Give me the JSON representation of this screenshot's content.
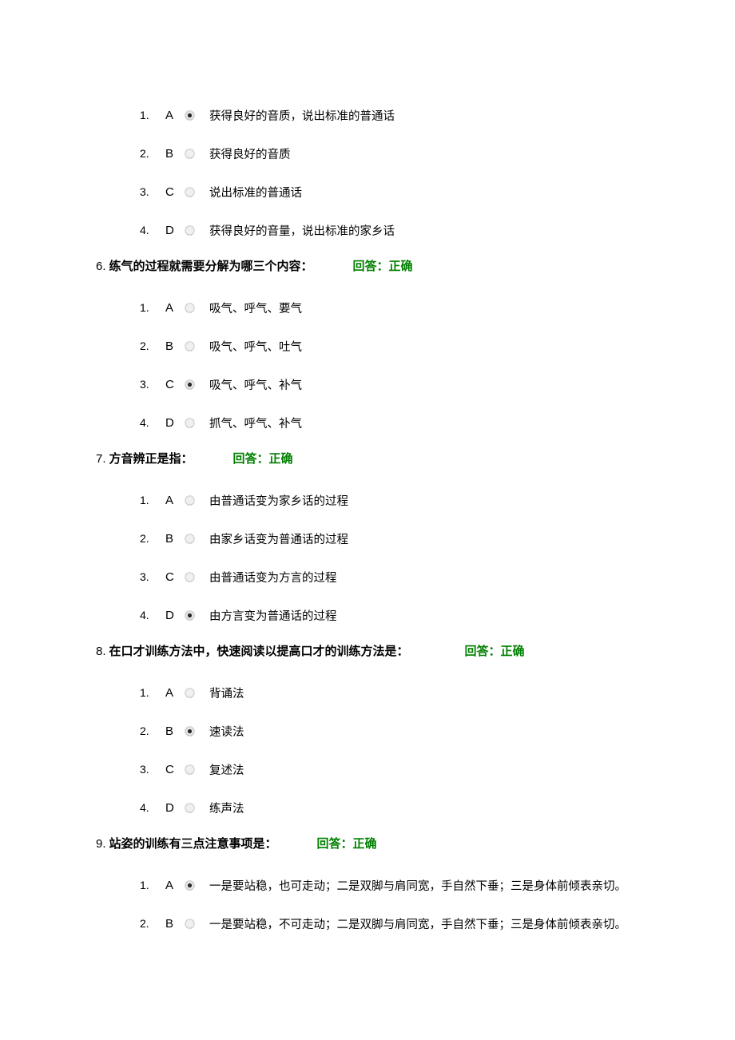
{
  "labels": {
    "answer_prefix": "回答：",
    "correct": "正确"
  },
  "block_a": {
    "options": [
      {
        "num": "1.",
        "letter": "A",
        "selected": true,
        "text": "获得良好的音质，说出标准的普通话"
      },
      {
        "num": "2.",
        "letter": "B",
        "selected": false,
        "text": "获得良好的音质"
      },
      {
        "num": "3.",
        "letter": "C",
        "selected": false,
        "text": "说出标准的普通话"
      },
      {
        "num": "4.",
        "letter": "D",
        "selected": false,
        "text": "获得良好的音量，说出标准的家乡话"
      }
    ]
  },
  "questions": [
    {
      "num": "6.",
      "text": "练气的过程就需要分解为哪三个内容：",
      "answer_gap": "50px",
      "options": [
        {
          "num": "1.",
          "letter": "A",
          "selected": false,
          "text": "吸气、呼气、要气"
        },
        {
          "num": "2.",
          "letter": "B",
          "selected": false,
          "text": "吸气、呼气、吐气"
        },
        {
          "num": "3.",
          "letter": "C",
          "selected": true,
          "text": "吸气、呼气、补气"
        },
        {
          "num": "4.",
          "letter": "D",
          "selected": false,
          "text": "抓气、呼气、补气"
        }
      ]
    },
    {
      "num": "7.",
      "text": "方音辨正是指：",
      "answer_gap": "50px",
      "options": [
        {
          "num": "1.",
          "letter": "A",
          "selected": false,
          "text": "由普通话变为家乡话的过程"
        },
        {
          "num": "2.",
          "letter": "B",
          "selected": false,
          "text": "由家乡话变为普通话的过程"
        },
        {
          "num": "3.",
          "letter": "C",
          "selected": false,
          "text": "由普通话变为方言的过程"
        },
        {
          "num": "4.",
          "letter": "D",
          "selected": true,
          "text": "由方言变为普通话的过程"
        }
      ]
    },
    {
      "num": "8.",
      "text": "在口才训练方法中，快速阅读以提高口才的训练方法是：",
      "answer_gap": "70px",
      "options": [
        {
          "num": "1.",
          "letter": "A",
          "selected": false,
          "text": "背诵法"
        },
        {
          "num": "2.",
          "letter": "B",
          "selected": true,
          "text": "速读法"
        },
        {
          "num": "3.",
          "letter": "C",
          "selected": false,
          "text": "复述法"
        },
        {
          "num": "4.",
          "letter": "D",
          "selected": false,
          "text": "练声法"
        }
      ]
    },
    {
      "num": "9.",
      "text": "站姿的训练有三点注意事项是：",
      "answer_gap": "50px",
      "options": [
        {
          "num": "1.",
          "letter": "A",
          "selected": true,
          "text": "一是要站稳，也可走动；二是双脚与肩同宽，手自然下垂；三是身体前倾表亲切。"
        },
        {
          "num": "2.",
          "letter": "B",
          "selected": false,
          "text": "一是要站稳，不可走动；二是双脚与肩同宽，手自然下垂；三是身体前倾表亲切。"
        }
      ]
    }
  ]
}
